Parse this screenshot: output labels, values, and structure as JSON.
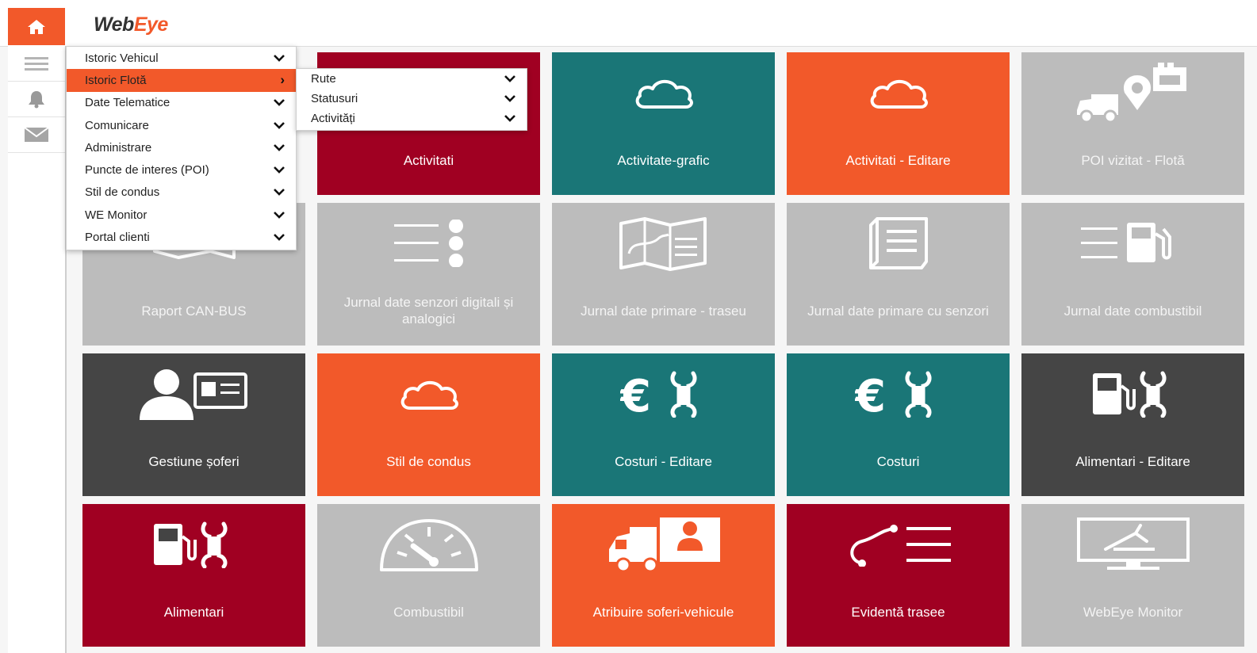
{
  "app": {
    "logo_web": "Web",
    "logo_eye": "Eye"
  },
  "colors": {
    "accent": "#f2592a",
    "maroon": "#a00022",
    "teal": "#1a7677",
    "gray": "#bcbcbc",
    "dark": "#454545"
  },
  "rail": {
    "icons": [
      "home-icon",
      "menu-icon",
      "bell-icon",
      "mail-icon"
    ]
  },
  "menu": {
    "items": [
      {
        "label": "Istoric Vehicul"
      },
      {
        "label": "Istoric Flotă"
      },
      {
        "label": "Date Telematice"
      },
      {
        "label": "Comunicare"
      },
      {
        "label": "Administrare"
      },
      {
        "label": "Puncte de interes (POI)"
      },
      {
        "label": "Stil de condus"
      },
      {
        "label": "WE Monitor"
      },
      {
        "label": "Portal clienti"
      }
    ],
    "active_index": 1
  },
  "submenu": {
    "items": [
      {
        "label": "Rute"
      },
      {
        "label": "Statusuri"
      },
      {
        "label": "Activități"
      }
    ]
  },
  "tiles": [
    {
      "label": "Activitati",
      "color": "maroon",
      "icon": "cloud-icon"
    },
    {
      "label": "Activitate-grafic",
      "color": "teal",
      "icon": "cloud-icon"
    },
    {
      "label": "Activitati - Editare",
      "color": "accent",
      "icon": "cloud-icon"
    },
    {
      "label": "POI vizitat - Flotă",
      "color": "gray",
      "icon": "truck-poi-icon"
    },
    {
      "label": "Raport CAN-BUS",
      "color": "gray",
      "icon": "map-icon"
    },
    {
      "label": "Jurnal date senzori digitali și analogici",
      "color": "gray",
      "icon": "list-dots-icon"
    },
    {
      "label": "Jurnal date primare - traseu",
      "color": "gray",
      "icon": "route-map-icon"
    },
    {
      "label": "Jurnal date primare cu senzori",
      "color": "gray",
      "icon": "document-icon"
    },
    {
      "label": "Jurnal date combustibil",
      "color": "gray",
      "icon": "fuel-list-icon"
    },
    {
      "label": "Gestiune șoferi",
      "color": "dark",
      "icon": "driver-card-icon"
    },
    {
      "label": "Stil de condus",
      "color": "accent",
      "icon": "cloud-icon"
    },
    {
      "label": "Costuri - Editare",
      "color": "teal",
      "icon": "euro-wrench-icon"
    },
    {
      "label": "Costuri",
      "color": "teal",
      "icon": "euro-wrench-icon"
    },
    {
      "label": "Alimentari - Editare",
      "color": "dark",
      "icon": "fuel-wrench-icon"
    },
    {
      "label": "Alimentari",
      "color": "maroon",
      "icon": "fuel-wrench-icon"
    },
    {
      "label": "Combustibil",
      "color": "gray",
      "icon": "gauge-icon"
    },
    {
      "label": "Atribuire soferi-vehicule",
      "color": "accent",
      "icon": "truck-driver-icon"
    },
    {
      "label": "Evidentă trasee",
      "color": "maroon",
      "icon": "route-list-icon"
    },
    {
      "label": "WebEye Monitor",
      "color": "gray",
      "icon": "monitor-icon"
    }
  ]
}
